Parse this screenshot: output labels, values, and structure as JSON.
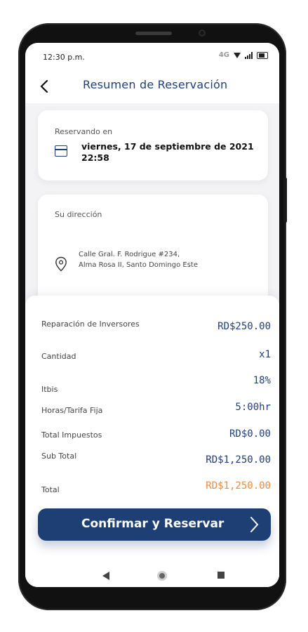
{
  "status_bar": {
    "time": "12:30 p.m.",
    "network": "4G"
  },
  "header": {
    "title": "Resumen de Reservación"
  },
  "booking_card": {
    "label": "Reservando en",
    "datetime_line1": "viernes, 17 de septiembre de 2021",
    "datetime_line2": "22:58"
  },
  "address_card": {
    "label": "Su dirección",
    "address_line1": "Calle Gral. F. Rodrigue #234,",
    "address_line2": "Alma Rosa II, Santo Domingo Este"
  },
  "summary": {
    "items": [
      {
        "label": "Reparación de Inversores",
        "value": "RD$250.00"
      },
      {
        "label": "Cantidad",
        "value": "x1"
      },
      {
        "label": "Itbis",
        "value": "18%"
      },
      {
        "label": "Horas/Tarifa Fija",
        "value": "5:00hr"
      },
      {
        "label": "Total Impuestos",
        "value": "RD$0.00"
      },
      {
        "label": "Sub Total",
        "value": "RD$1,250.00"
      },
      {
        "label": "Total",
        "value": "RD$1,250.00"
      }
    ]
  },
  "cta": {
    "label": "Confirmar y Reservar"
  },
  "icons": {
    "back": "chevron-left-icon",
    "calendar": "calendar-icon",
    "location": "location-pin-icon",
    "arrow": "chevron-right-icon"
  },
  "colors": {
    "primary": "#1e3f74",
    "accent": "#f08a3c"
  }
}
